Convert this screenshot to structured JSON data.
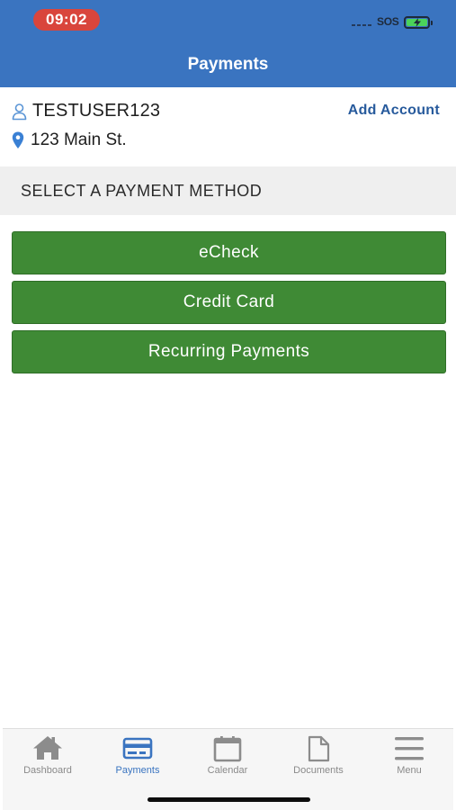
{
  "status_bar": {
    "time": "09:02",
    "carrier": "SOS",
    "battery_color": "#4bd35a"
  },
  "header": {
    "title": "Payments",
    "background": "#3a74c0"
  },
  "account": {
    "username": "TESTUSER123",
    "user_icon": "person-icon",
    "address": "123 Main St.",
    "address_icon": "location-pin-icon",
    "add_account_label": "Add Account"
  },
  "section": {
    "title": "SELECT A PAYMENT METHOD"
  },
  "payment_methods": [
    {
      "label": "eCheck"
    },
    {
      "label": "Credit Card"
    },
    {
      "label": "Recurring Payments"
    }
  ],
  "button_color": "#3f8a35",
  "tabs": [
    {
      "label": "Dashboard",
      "icon": "home-icon",
      "active": false
    },
    {
      "label": "Payments",
      "icon": "credit-card-icon",
      "active": true
    },
    {
      "label": "Calendar",
      "icon": "calendar-icon",
      "active": false
    },
    {
      "label": "Documents",
      "icon": "document-icon",
      "active": false
    },
    {
      "label": "Menu",
      "icon": "hamburger-menu-icon",
      "active": false
    }
  ],
  "active_tab_color": "#3a74c0"
}
